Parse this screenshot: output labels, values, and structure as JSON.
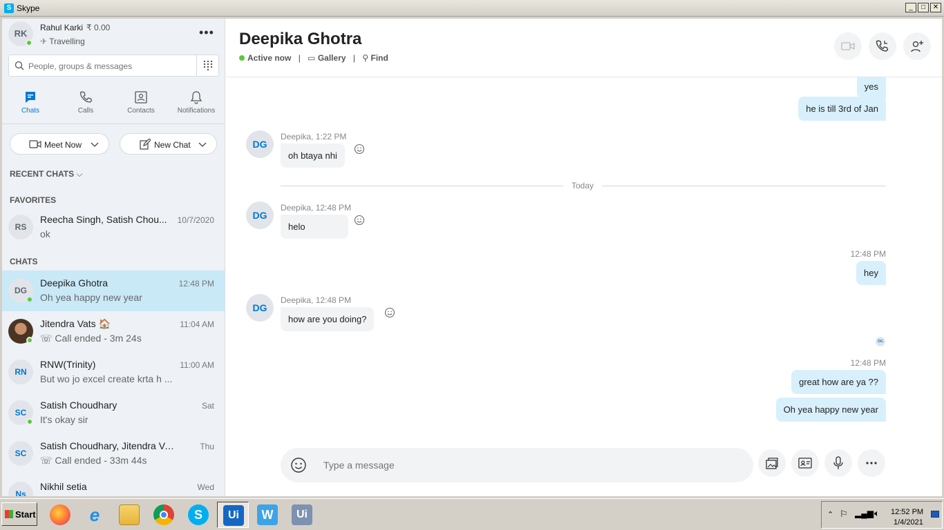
{
  "window": {
    "title": "Skype"
  },
  "profile": {
    "initials": "RK",
    "name": "Rahul Karki",
    "credit": "₹ 0.00",
    "mood": "Travelling"
  },
  "search": {
    "placeholder": "People, groups & messages"
  },
  "nav": {
    "tabs": [
      {
        "label": "Chats"
      },
      {
        "label": "Calls"
      },
      {
        "label": "Contacts"
      },
      {
        "label": "Notifications"
      }
    ]
  },
  "actions": {
    "meet_now": "Meet Now",
    "new_chat": "New Chat"
  },
  "sections": {
    "recent": "RECENT CHATS",
    "favorites": "FAVORITES",
    "chats": "CHATS"
  },
  "favorites": [
    {
      "initials": "RS",
      "name": "Reecha Singh, Satish Chou...",
      "preview": "ok",
      "time": "10/7/2020"
    }
  ],
  "chats": [
    {
      "initials": "DG",
      "name": "Deepika Ghotra",
      "preview": "Oh yea happy new year",
      "time": "12:48 PM"
    },
    {
      "initials": "",
      "name": "Jitendra Vats 🏠",
      "preview": "Call ended - 3m 24s",
      "time": "11:04 AM"
    },
    {
      "initials": "RN",
      "name": "RNW(Trinity)",
      "preview": "But wo jo excel create krta h ...",
      "time": "11:00 AM"
    },
    {
      "initials": "SC",
      "name": "Satish Choudhary",
      "preview": "It's okay sir",
      "time": "Sat"
    },
    {
      "initials": "SC",
      "name": "Satish Choudhary, Jitendra Vats,...",
      "preview": "Call ended - 33m 44s",
      "time": "Thu"
    },
    {
      "initials": "Ns",
      "name": "Nikhil setia",
      "preview": "",
      "time": "Wed"
    }
  ],
  "conversation": {
    "name": "Deepika Ghotra",
    "status": "Active now",
    "gallery": "Gallery",
    "find": "Find",
    "contact_initials": "DG",
    "divider": "Today",
    "read_receipt": "DG",
    "messages": {
      "out1": "yes",
      "out2": "he is till 3rd of Jan",
      "in1_meta": "Deepika, 1:22 PM",
      "in1": "oh btaya nhi",
      "in2_meta": "Deepika, 12:48 PM",
      "in2": "helo",
      "out3_meta": "12:48 PM",
      "out3": "hey",
      "in3_meta": "Deepika, 12:48 PM",
      "in3": "how are you doing?",
      "out4_meta": "12:48 PM",
      "out4": "great how are ya ??",
      "out5": "Oh yea happy new year"
    },
    "composer_placeholder": "Type a message"
  },
  "taskbar": {
    "start": "Start",
    "apps": [
      {
        "name": "firefox",
        "glyph": ""
      },
      {
        "name": "internet-explorer",
        "glyph": "e"
      },
      {
        "name": "file-explorer",
        "glyph": ""
      },
      {
        "name": "chrome",
        "glyph": ""
      },
      {
        "name": "skype",
        "glyph": "S"
      },
      {
        "name": "uipath",
        "glyph": "Ui"
      },
      {
        "name": "word",
        "glyph": "W"
      },
      {
        "name": "uipath-2",
        "glyph": "Ui"
      }
    ],
    "time": "12:52 PM",
    "date": "1/4/2021"
  },
  "colors": {
    "accent": "#0078d4",
    "selected": "#c9e9f7",
    "outgoing": "#d8f0fb",
    "online": "#5fc73a"
  }
}
